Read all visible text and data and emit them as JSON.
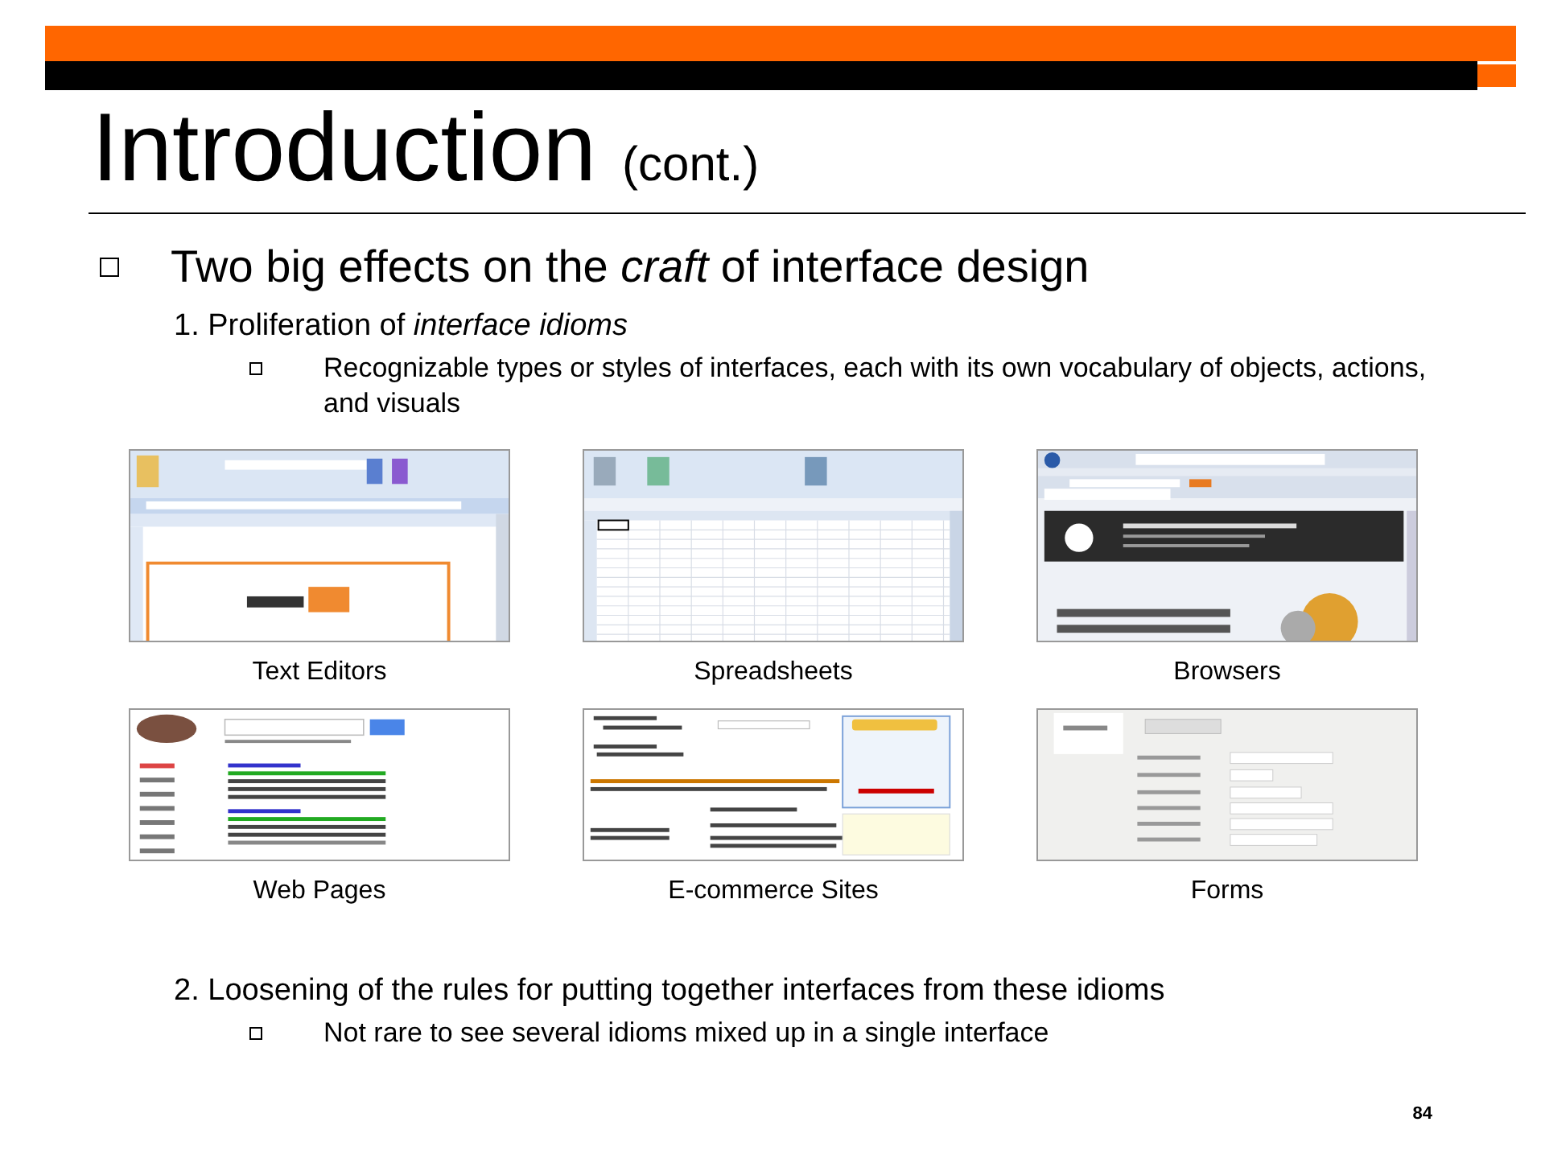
{
  "title": "Introduction",
  "title_suffix": "(cont.)",
  "main_bullet": {
    "text": "Two big effects on the *craft* of interface design"
  },
  "point_1": {
    "number": "1.",
    "text": "Proliferation of *interface idioms*",
    "subitems": [
      "Recognizable types or styles of interfaces, each with its own vocabulary of objects, actions, and visuals"
    ]
  },
  "gallery": [
    {
      "kind": "word",
      "caption": "Text Editors"
    },
    {
      "kind": "spreadsheet",
      "caption": "Spreadsheets"
    },
    {
      "kind": "browser",
      "caption": "Browsers"
    },
    {
      "kind": "search",
      "caption": "Web Pages"
    },
    {
      "kind": "checkout",
      "caption": "E-commerce Sites"
    },
    {
      "kind": "form",
      "caption": "Forms"
    }
  ],
  "point_2": {
    "number": "2.",
    "text": "Loosening of the rules for putting together interfaces from these idioms",
    "subitems": [
      "Not rare to see several idioms mixed up in a single interface"
    ]
  },
  "page_number": "84"
}
